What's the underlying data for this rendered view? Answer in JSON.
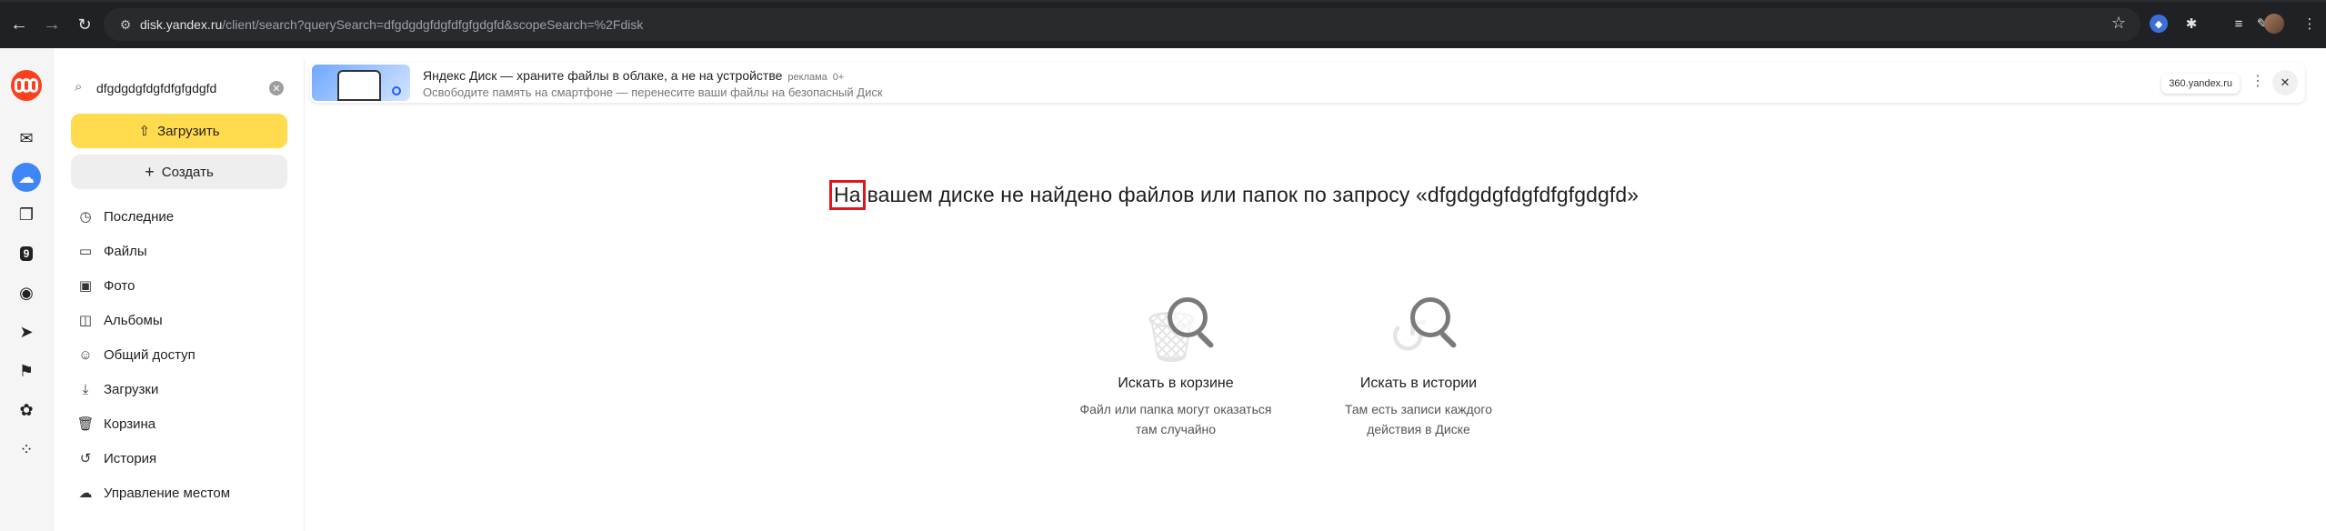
{
  "browser": {
    "url_host": "disk.yandex.ru",
    "url_path": "/client/search?querySearch=dfgdgdgfdgfdfgfgdgfd&scopeSearch=%2Fdisk"
  },
  "appbar": {
    "items": [
      "mail-icon",
      "disk-icon",
      "docs-icon",
      "calendar-icon",
      "telemost-icon",
      "messenger-icon",
      "notes-icon",
      "family-icon",
      "all-services-icon"
    ],
    "calendar_badge": "9"
  },
  "sidebar": {
    "search_value": "dfgdgdgfdgfdfgfgdgfd",
    "upload_label": "Загрузить",
    "create_label": "Создать",
    "items": [
      {
        "label": "Последние",
        "icon": "clock-icon"
      },
      {
        "label": "Файлы",
        "icon": "folder-icon"
      },
      {
        "label": "Фото",
        "icon": "photo-icon"
      },
      {
        "label": "Альбомы",
        "icon": "album-icon"
      },
      {
        "label": "Общий доступ",
        "icon": "shared-icon"
      },
      {
        "label": "Загрузки",
        "icon": "download-icon"
      },
      {
        "label": "Корзина",
        "icon": "trash-icon"
      },
      {
        "label": "История",
        "icon": "history-icon"
      },
      {
        "label": "Управление местом",
        "icon": "cloud-icon"
      }
    ]
  },
  "promo": {
    "title": "Яндекс Диск — храните файлы в облаке, а не на устройстве",
    "ad_label": "реклама",
    "age": "0+",
    "subtitle": "Освободите память на смартфоне — перенесите ваши файлы на безопасный Диск",
    "domain": "360.yandex.ru"
  },
  "main": {
    "empty_highlight": "На",
    "empty_rest": "вашем диске не найдено файлов или папок по запросу «dfgdgdgfdgfdfgfgdgfd»",
    "options": [
      {
        "title": "Искать в корзине",
        "desc1": "Файл или папка могут оказаться",
        "desc2": "там случайно"
      },
      {
        "title": "Искать в истории",
        "desc1": "Там есть записи каждого",
        "desc2": "действия в Диске"
      }
    ]
  },
  "colors": {
    "accent_yellow": "#ffdb4d",
    "highlight_red": "#e0161b",
    "active_blue": "#3e86f6"
  }
}
